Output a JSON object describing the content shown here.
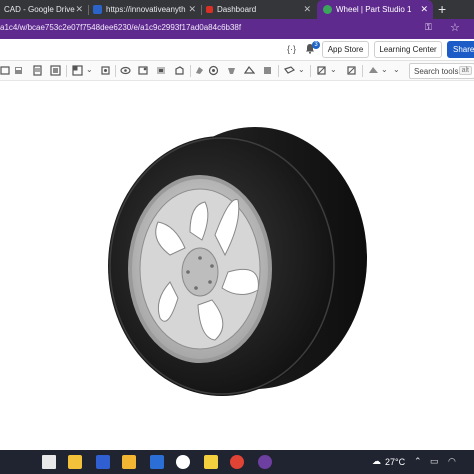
{
  "browser": {
    "tabs": [
      {
        "label": "CAD - Google Drive",
        "favicon": "google-drive-icon",
        "active": false
      },
      {
        "label": "https://innovativeanything.",
        "favicon": "site-icon",
        "active": false
      },
      {
        "label": "Dashboard",
        "favicon": "dashboard-icon",
        "active": false
      },
      {
        "label": "Wheel | Part Studio 1",
        "favicon": "onshape-icon",
        "active": true
      }
    ],
    "new_tab": "+",
    "url": "a1c4/w/bcae753c2e07f7548dee6230/e/a1c9c2993f17ad0a84c6b38f"
  },
  "header": {
    "code_label": "{·}",
    "notifications_count": "3",
    "app_store_label": "App Store",
    "learning_center_label": "Learning Center",
    "share_label": "Share"
  },
  "toolbar": {
    "search_placeholder": "Search tools...",
    "search_shortcut": "alt"
  },
  "taskbar": {
    "temperature": "27°C",
    "icons": [
      "file-explorer-icon",
      "photos-icon",
      "calculator-icon",
      "folder-icon",
      "mail-icon",
      "dell-icon",
      "sticky-notes-icon",
      "chrome-icon",
      "chrome-profile-icon"
    ]
  },
  "colors": {
    "tab_active": "#5f2a8e",
    "address_bar": "#5f2a8e",
    "share_button": "#1d5cc6",
    "taskbar": "#1f2430",
    "tire": "#1c1c1c",
    "rim": "#c9c9c9"
  }
}
